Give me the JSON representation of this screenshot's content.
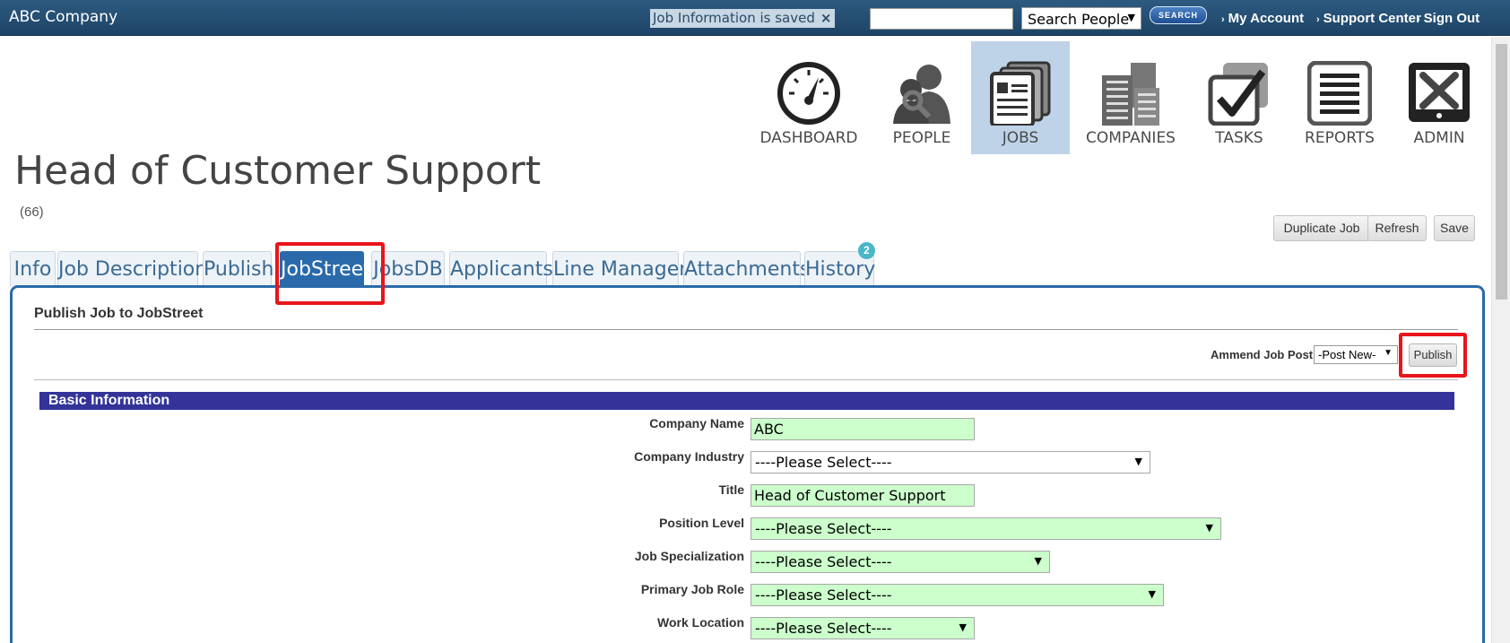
{
  "topbar": {
    "brand": "ABC Company",
    "notice": "Job Information is saved",
    "notice_close": "×",
    "search_value": "",
    "search_scope": "Search People",
    "search_button": "SEARCH",
    "links": [
      "My Account",
      "Support Center",
      "Sign Out"
    ]
  },
  "nav": {
    "items": [
      {
        "label": "DASHBOARD",
        "icon": "dashboard-icon"
      },
      {
        "label": "PEOPLE",
        "icon": "people-icon"
      },
      {
        "label": "JOBS",
        "icon": "jobs-icon",
        "active": true
      },
      {
        "label": "COMPANIES",
        "icon": "companies-icon"
      },
      {
        "label": "TASKS",
        "icon": "tasks-icon"
      },
      {
        "label": "REPORTS",
        "icon": "reports-icon"
      },
      {
        "label": "ADMIN",
        "icon": "admin-icon"
      }
    ]
  },
  "page": {
    "title": "Head of Customer Support",
    "count": "(66)"
  },
  "actions": {
    "duplicate": "Duplicate Job",
    "refresh": "Refresh",
    "save": "Save"
  },
  "tabs": {
    "items": [
      "Info",
      "Job Description",
      "Publish",
      "JobStreet",
      "JobsDB",
      "Applicants",
      "Line Manager",
      "Attachments",
      "History"
    ],
    "active": "JobStreet",
    "history_badge": "2"
  },
  "panel": {
    "title": "Publish Job to JobStreet",
    "amend_label": "Ammend Job Post",
    "amend_value": "-Post New-",
    "publish_button": "Publish"
  },
  "basic_info": {
    "heading": "Basic Information",
    "fields": {
      "company_name": {
        "label": "Company Name",
        "value": "ABC"
      },
      "company_industry": {
        "label": "Company Industry",
        "value": "----Please Select----"
      },
      "title": {
        "label": "Title",
        "value": "Head of Customer Support"
      },
      "position_level": {
        "label": "Position Level",
        "value": "----Please Select----"
      },
      "job_specialization": {
        "label": "Job Specialization",
        "value": "----Please Select----"
      },
      "primary_job_role": {
        "label": "Primary Job Role",
        "value": "----Please Select----"
      },
      "work_location": {
        "label": "Work Location",
        "value": "----Please Select----"
      }
    }
  },
  "colors": {
    "topbar": "#1d4466",
    "active_nav": "#bed3e8",
    "active_tab": "#2a6aaa",
    "section_bar": "#333399",
    "required_field": "#ccffcc",
    "highlight": "#e8151b"
  }
}
